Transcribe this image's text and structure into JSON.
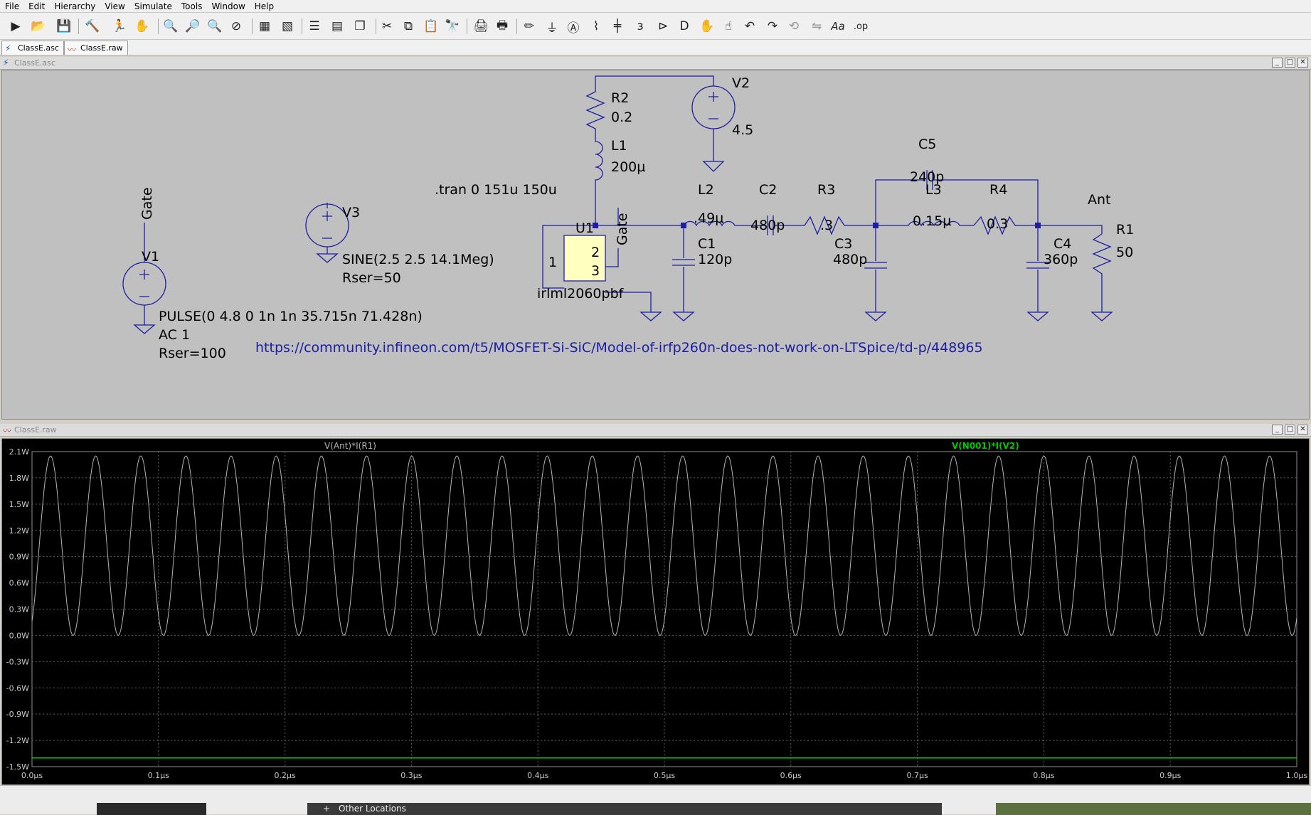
{
  "menu": [
    "File",
    "Edit",
    "Hierarchy",
    "View",
    "Simulate",
    "Tools",
    "Window",
    "Help"
  ],
  "toolbar": {
    "icons": [
      "run-icon",
      "open-icon",
      "save-icon",
      "control-panel-icon",
      "halt-icon",
      "pan-icon",
      "zoom-in-icon",
      "zoom-fit-icon",
      "zoom-out-icon",
      "zoom-cancel-icon",
      "autorange-icon",
      "mark-unconnected-icon",
      "tile-horizontal-icon",
      "tile-vertical-icon",
      "cascade-icon",
      "cut-icon",
      "copy-icon",
      "paste-icon",
      "find-icon",
      "print-icon",
      "print-setup-icon",
      "draw-wire-icon",
      "ground-icon",
      "label-net-icon",
      "resistor-icon",
      "capacitor-icon",
      "inductor-icon",
      "diode-icon",
      "component-icon",
      "move-icon",
      "drag-icon",
      "undo-icon",
      "redo-icon",
      "rotate-icon",
      "mirror-icon",
      "text-icon",
      "spice-directive-icon"
    ],
    "text_labels": {
      "text": "Aa",
      "op": ".op"
    }
  },
  "tabs": [
    {
      "label": "ClassE.asc",
      "icon": "schematic-icon"
    },
    {
      "label": "ClassE.raw",
      "icon": "waveform-icon"
    }
  ],
  "schematic_window": {
    "title": "ClassE.asc",
    "directive": ".tran 0 151u 150u",
    "link": "https://community.infineon.com/t5/MOSFET-Si-SiC/Model-of-irfp260n-does-not-work-on-LTSpice/td-p/448965",
    "net_labels": {
      "gate_left": "Gate",
      "gate_u1": "Gate",
      "ant": "Ant"
    },
    "V1": {
      "name": "V1",
      "value": "PULSE(0 4.8 0 1n 1n 35.715n 71.428n)",
      "ac": "AC 1",
      "rser": "Rser=100"
    },
    "V2": {
      "name": "V2",
      "value": "4.5"
    },
    "V3": {
      "name": "V3",
      "value": "SINE(2.5 2.5 14.1Meg)",
      "rser": "Rser=50"
    },
    "R1": {
      "name": "R1",
      "value": "50"
    },
    "R2": {
      "name": "R2",
      "value": "0.2"
    },
    "R3": {
      "name": "R3",
      "value": ".3"
    },
    "R4": {
      "name": "R4",
      "value": "0.3"
    },
    "L1": {
      "name": "L1",
      "value": "200µ"
    },
    "L2": {
      "name": "L2",
      "value": ".49µ"
    },
    "L3": {
      "name": "L3",
      "value": "0.15µ"
    },
    "C1": {
      "name": "C1",
      "value": "120p"
    },
    "C2": {
      "name": "C2",
      "value": "480p"
    },
    "C3": {
      "name": "C3",
      "value": "480p"
    },
    "C4": {
      "name": "C4",
      "value": "360p"
    },
    "C5": {
      "name": "C5",
      "value": "240p"
    },
    "U1": {
      "name": "U1",
      "model": "irlml2060pbf",
      "pin1": "1",
      "pin2": "2",
      "pin3": "3"
    }
  },
  "waveform_window": {
    "title": "ClassE.raw",
    "trace1_label": "V(Ant)*I(R1)",
    "trace2_label": "V(N001)*I(V2)",
    "trace1_color": "#b4b4b4",
    "trace2_color": "#00c800"
  },
  "chart_data": {
    "type": "line",
    "ylim": [
      -1.5,
      2.1
    ],
    "xlim": [
      0.0,
      1.0
    ],
    "y_ticks": [
      "2.1W",
      "1.8W",
      "1.5W",
      "1.2W",
      "0.9W",
      "0.6W",
      "0.3W",
      "0.0W",
      "-0.3W",
      "-0.6W",
      "-0.9W",
      "-1.2W",
      "-1.5W"
    ],
    "x_ticks": [
      "0.0µs",
      "0.1µs",
      "0.2µs",
      "0.3µs",
      "0.4µs",
      "0.5µs",
      "0.6µs",
      "0.7µs",
      "0.8µs",
      "0.9µs",
      "1.0µs"
    ],
    "grid": true,
    "series": [
      {
        "name": "V(Ant)*I(R1)",
        "model": "sine-squared",
        "period_us": 0.0357,
        "min": 0.0,
        "max": 2.05
      },
      {
        "name": "V(N001)*I(V2)",
        "model": "constant",
        "value": -1.4
      }
    ]
  },
  "taskbar": {
    "other_locations": "Other Locations"
  }
}
